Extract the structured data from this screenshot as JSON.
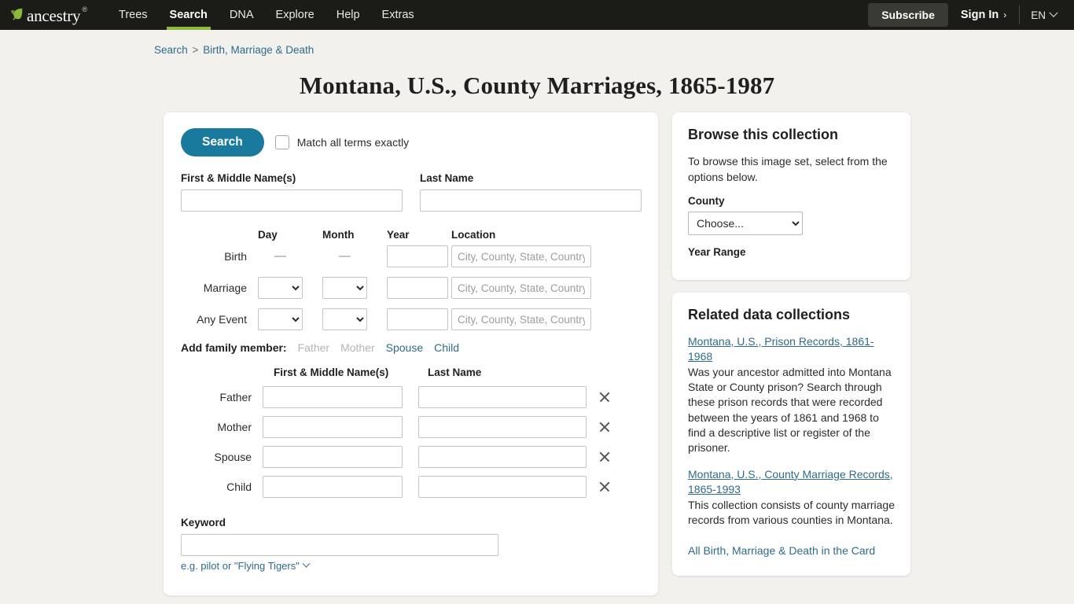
{
  "nav": {
    "brand": "ancestry",
    "brand_tm": "®",
    "leaf_icon": "leaf-icon",
    "links": [
      {
        "label": "Trees",
        "active": false
      },
      {
        "label": "Search",
        "active": true
      },
      {
        "label": "DNA",
        "active": false
      },
      {
        "label": "Explore",
        "active": false
      },
      {
        "label": "Help",
        "active": false
      },
      {
        "label": "Extras",
        "active": false
      }
    ],
    "subscribe_label": "Subscribe",
    "signin_label": "Sign In",
    "signin_chevron": "›",
    "language_label": "EN",
    "accent_green": "#8cb83c",
    "bar_color": "#1b1b17"
  },
  "breadcrumb": {
    "root": "Search",
    "separator": ">",
    "current": "Birth, Marriage & Death"
  },
  "page": {
    "title": "Montana, U.S., County Marriages, 1865-1987",
    "background": "#f3f1ed"
  },
  "form": {
    "search_button": "Search",
    "match_exact_label": "Match all terms exactly",
    "match_exact_checked": false,
    "first_name": {
      "label": "First & Middle Name(s)",
      "value": "",
      "placeholder": ""
    },
    "last_name": {
      "label": "Last Name",
      "value": "",
      "placeholder": ""
    },
    "event_headers": {
      "day": "Day",
      "month": "Month",
      "year": "Year",
      "location": "Location"
    },
    "events": [
      {
        "label": "Birth",
        "day_type": "dash",
        "day_value": "—",
        "month_type": "dash",
        "month_value": "—",
        "year_value": "",
        "year_placeholder": "",
        "location_value": "",
        "location_placeholder": "City, County, State, Country"
      },
      {
        "label": "Marriage",
        "day_type": "select",
        "day_value": "",
        "month_type": "select",
        "month_value": "",
        "year_value": "",
        "year_placeholder": "",
        "location_value": "",
        "location_placeholder": "City, County, State, Country"
      },
      {
        "label": "Any Event",
        "day_type": "select",
        "day_value": "",
        "month_type": "select",
        "month_value": "",
        "year_value": "",
        "year_placeholder": "",
        "location_value": "",
        "location_placeholder": "City, County, State, Country"
      }
    ],
    "add_family_label": "Add family member:",
    "add_family_links": [
      {
        "label": "Father",
        "disabled": true
      },
      {
        "label": "Mother",
        "disabled": true
      },
      {
        "label": "Spouse",
        "disabled": false
      },
      {
        "label": "Child",
        "disabled": false
      }
    ],
    "family_headers": {
      "first": "First & Middle Name(s)",
      "last": "Last Name"
    },
    "family_rows": [
      {
        "label": "Father",
        "first": "",
        "last": "",
        "remove_icon": "close-icon"
      },
      {
        "label": "Mother",
        "first": "",
        "last": "",
        "remove_icon": "close-icon"
      },
      {
        "label": "Spouse",
        "first": "",
        "last": "",
        "remove_icon": "close-icon"
      },
      {
        "label": "Child",
        "first": "",
        "last": "",
        "remove_icon": "close-icon"
      }
    ],
    "keyword": {
      "label": "Keyword",
      "value": "",
      "placeholder": "",
      "hint": "e.g. pilot or \"Flying Tigers\""
    },
    "search_button_color": "#1a7a9e"
  },
  "sidebar": {
    "browse": {
      "heading": "Browse this collection",
      "description": "To browse this image set, select from the options below.",
      "county_label": "County",
      "county_value": "Choose...",
      "year_range_label": "Year Range"
    },
    "related": {
      "heading": "Related data collections",
      "items": [
        {
          "link": "Montana, U.S., Prison Records, 1861-1968",
          "desc": "Was your ancestor admitted into Montana State or County prison? Search through these prison records that were recorded between the years of 1861 and 1968 to find a descriptive list or register of the prisoner."
        },
        {
          "link": "Montana, U.S., County Marriage Records, 1865-1993",
          "desc": "This collection consists of county marriage records from various counties in Montana."
        }
      ],
      "bottom_link": "All Birth, Marriage & Death in the Card"
    }
  }
}
